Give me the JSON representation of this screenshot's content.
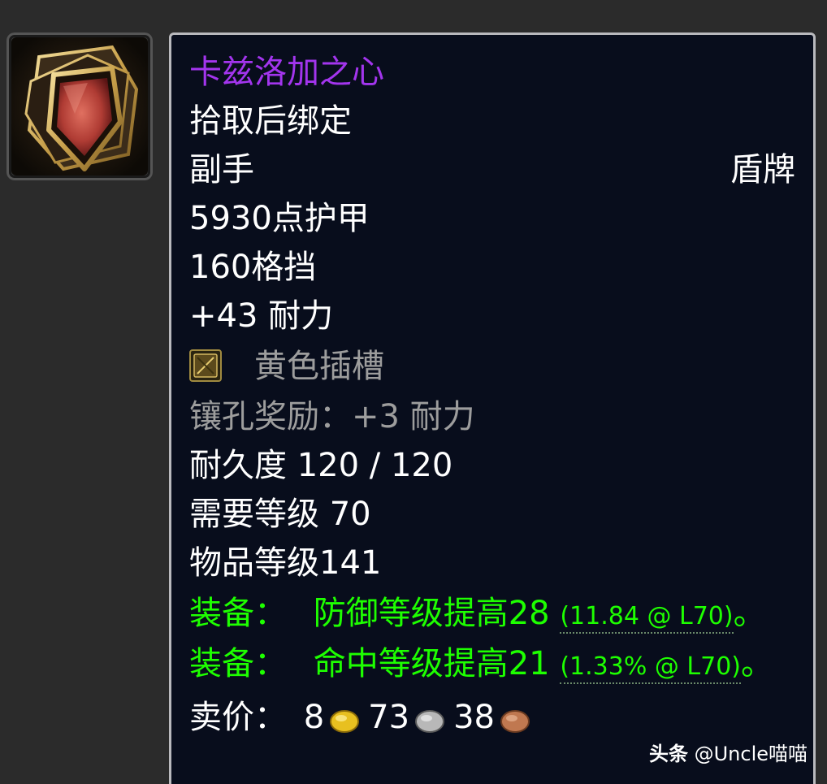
{
  "item": {
    "name": "卡兹洛加之心",
    "binding": "拾取后绑定",
    "slot": "副手",
    "type": "盾牌",
    "armor": "5930点护甲",
    "block": "160格挡",
    "stamina": "+43 耐力",
    "socket": "黄色插槽",
    "socket_bonus": "镶孔奖励：+3 耐力",
    "durability": "耐久度 120 / 120",
    "required_level": "需要等级 70",
    "item_level": "物品等级141",
    "equip_effects": [
      {
        "prefix": "装备：",
        "text": "防御等级提高28",
        "detail": "(11.84 @ L70)",
        "suffix": "。"
      },
      {
        "prefix": "装备：",
        "text": "命中等级提高21",
        "detail": "(1.33% @ L70)",
        "suffix": "。"
      }
    ],
    "sell_price": {
      "label": "卖价：",
      "gold": "8",
      "silver": "73",
      "copper": "38"
    }
  },
  "icons": {
    "item_icon": "shield-icon",
    "socket_icon": "yellow-socket-icon",
    "gold_icon": "gold-coin-icon",
    "silver_icon": "silver-coin-icon",
    "copper_icon": "copper-coin-icon"
  },
  "colors": {
    "epic": "#a335ee",
    "uncommon_green": "#1eff00",
    "disabled_gray": "#9d9d9d",
    "tooltip_bg": "#080d1c"
  },
  "watermark": {
    "brand": "头条",
    "handle": "@Uncle喵喵"
  }
}
